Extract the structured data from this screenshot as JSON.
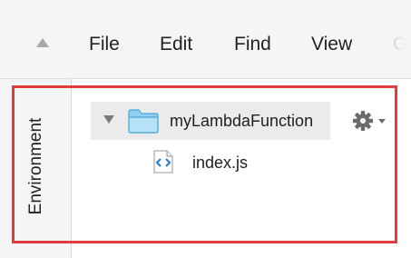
{
  "menubar": {
    "collapse_icon": "triangle-up-icon",
    "items": [
      {
        "label": "File"
      },
      {
        "label": "Edit"
      },
      {
        "label": "Find"
      },
      {
        "label": "View"
      },
      {
        "label": "G"
      }
    ]
  },
  "sidebar": {
    "tab_label": "Environment"
  },
  "tree": {
    "root": {
      "label": "myLambdaFunction",
      "icon": "folder-icon",
      "expanded": true
    },
    "children": [
      {
        "label": "index.js",
        "icon": "js-file-icon"
      }
    ],
    "settings_icon": "gear-icon"
  },
  "colors": {
    "highlight": "#e03c3c",
    "folder": "#5cb7e6",
    "file_icon_accent": "#2f7fd1",
    "menubar_bg": "#f5f5f5",
    "selected_row_bg": "#ebebeb"
  }
}
